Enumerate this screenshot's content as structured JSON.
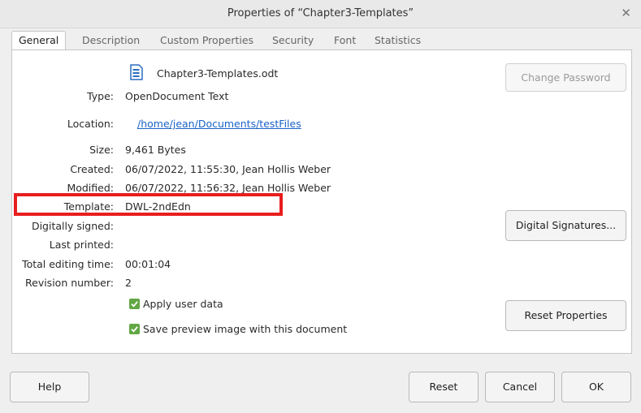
{
  "window": {
    "title": "Properties of “Chapter3-Templates”",
    "close_icon": "close-icon"
  },
  "tabs": [
    {
      "label": "General",
      "active": true
    },
    {
      "label": "Description",
      "active": false
    },
    {
      "label": "Custom Properties",
      "active": false
    },
    {
      "label": "Security",
      "active": false
    },
    {
      "label": "Font",
      "active": false
    },
    {
      "label": "Statistics",
      "active": false
    }
  ],
  "general": {
    "file_name": "Chapter3-Templates.odt",
    "file_icon": "document-icon",
    "type_label": "Type:",
    "type_value": "OpenDocument Text",
    "location_label": "Location:",
    "location_value": "/home/jean/Documents/testFiles",
    "size_label": "Size:",
    "size_value": "9,461 Bytes",
    "created_label": "Created:",
    "created_value": "06/07/2022, 11:55:30, Jean Hollis Weber",
    "modified_label": "Modified:",
    "modified_value": "06/07/2022, 11:56:32, Jean Hollis Weber",
    "template_label": "Template:",
    "template_value": "DWL-2ndEdn",
    "signed_label": "Digitally signed:",
    "signed_value": "",
    "printed_label": "Last printed:",
    "printed_value": "",
    "editing_label": "Total editing time:",
    "editing_value": "00:01:04",
    "revision_label": "Revision number:",
    "revision_value": "2",
    "apply_user_data": {
      "label": "Apply user data",
      "checked": true
    },
    "save_preview": {
      "label": "Save preview image with this document",
      "checked": true
    },
    "change_password": "Change Password",
    "digital_signatures": "Digital Signatures...",
    "reset_properties": "Reset Properties"
  },
  "footer": {
    "help": "Help",
    "reset": "Reset",
    "cancel": "Cancel",
    "ok": "OK"
  },
  "colors": {
    "highlight": "#e81e1e",
    "checkbox": "#62a744",
    "link": "#1a62c6"
  }
}
